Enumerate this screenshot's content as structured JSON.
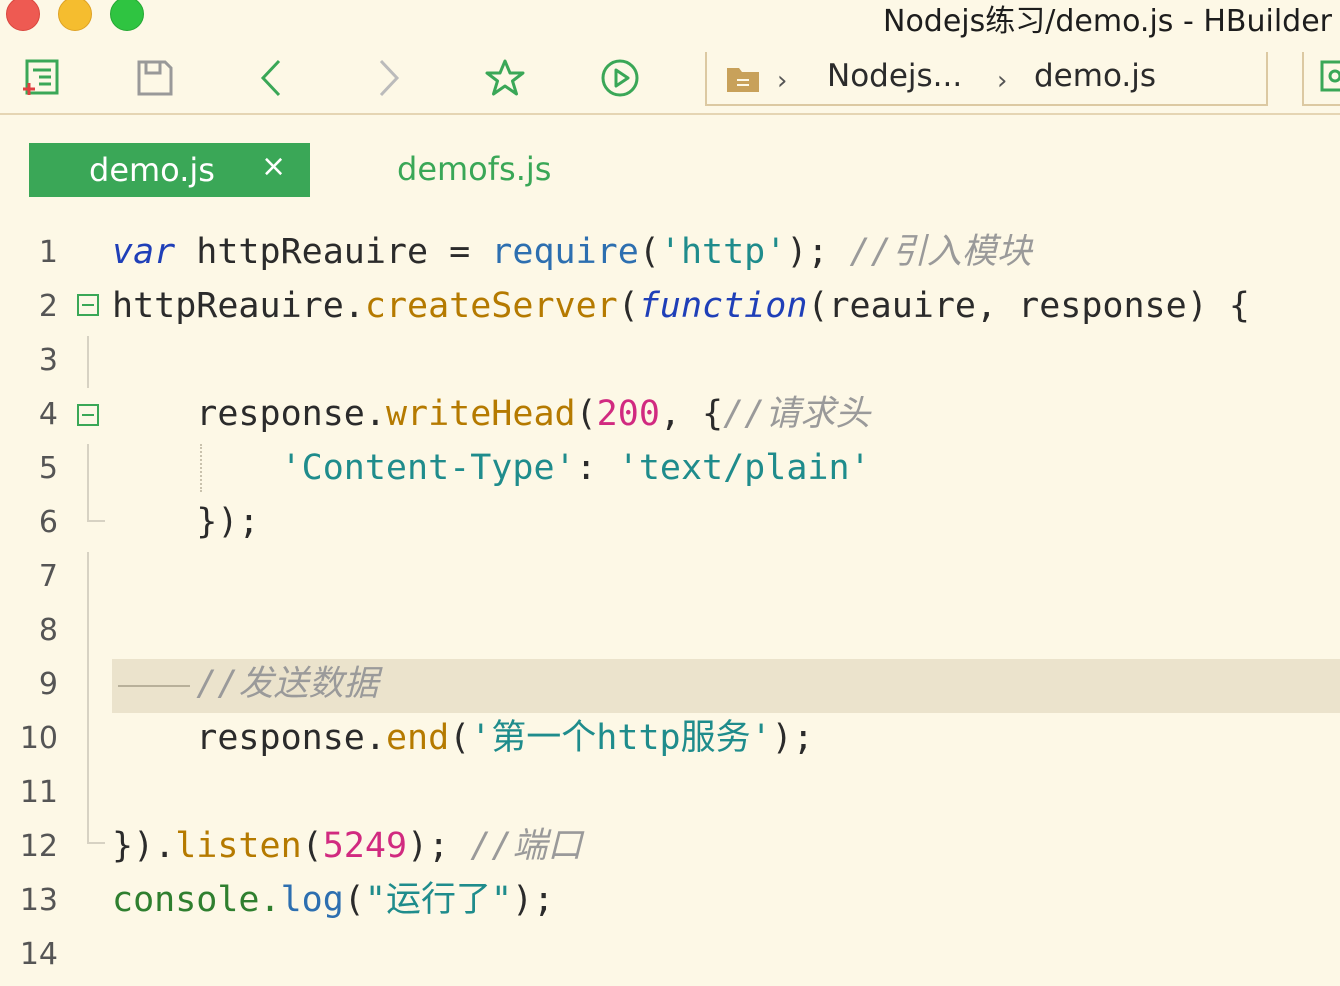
{
  "window": {
    "title": "Nodejs练习/demo.js - HBuilder"
  },
  "toolbar": {
    "buttons": [
      "new-file-icon",
      "save-icon",
      "back-icon",
      "forward-icon",
      "favorite-icon",
      "run-icon"
    ],
    "breadcrumb": {
      "project": "Nodejs...",
      "file": "demo.js"
    }
  },
  "tabs": [
    {
      "label": "demo.js",
      "active": true,
      "close": "×"
    },
    {
      "label": "demofs.js",
      "active": false
    }
  ],
  "editor": {
    "line_numbers": [
      "1",
      "2",
      "3",
      "4",
      "5",
      "6",
      "7",
      "8",
      "9",
      "10",
      "11",
      "12",
      "13",
      "14"
    ],
    "highlighted_line": "9",
    "lines": [
      [
        {
          "t": "var",
          "c": "kw"
        },
        {
          "t": " httpReauire = ",
          "c": "plain"
        },
        {
          "t": "require",
          "c": "req"
        },
        {
          "t": "(",
          "c": "plain"
        },
        {
          "t": "'http'",
          "c": "str"
        },
        {
          "t": "); ",
          "c": "plain"
        },
        {
          "t": "//引入模块",
          "c": "cm"
        }
      ],
      [
        {
          "t": "httpReauire.",
          "c": "plain"
        },
        {
          "t": "createServer",
          "c": "fn"
        },
        {
          "t": "(",
          "c": "plain"
        },
        {
          "t": "function",
          "c": "kw"
        },
        {
          "t": "(reauire, response) {",
          "c": "plain"
        }
      ],
      [],
      [
        {
          "t": "    response.",
          "c": "plain"
        },
        {
          "t": "writeHead",
          "c": "fn"
        },
        {
          "t": "(",
          "c": "plain"
        },
        {
          "t": "200",
          "c": "num"
        },
        {
          "t": ", {",
          "c": "plain"
        },
        {
          "t": "//请求头",
          "c": "cm"
        }
      ],
      [
        {
          "t": "        ",
          "c": "plain"
        },
        {
          "t": "'Content-Type'",
          "c": "str"
        },
        {
          "t": ": ",
          "c": "plain"
        },
        {
          "t": "'text/plain'",
          "c": "str"
        }
      ],
      [
        {
          "t": "    });",
          "c": "plain"
        }
      ],
      [],
      [],
      [
        {
          "t": "    ",
          "c": "plain"
        },
        {
          "t": "//发送数据",
          "c": "cm"
        }
      ],
      [
        {
          "t": "    response.",
          "c": "plain"
        },
        {
          "t": "end",
          "c": "fn"
        },
        {
          "t": "(",
          "c": "plain"
        },
        {
          "t": "'第一个http服务'",
          "c": "str"
        },
        {
          "t": ");",
          "c": "plain"
        }
      ],
      [],
      [
        {
          "t": "}).",
          "c": "plain"
        },
        {
          "t": "listen",
          "c": "fn"
        },
        {
          "t": "(",
          "c": "plain"
        },
        {
          "t": "5249",
          "c": "num"
        },
        {
          "t": "); ",
          "c": "plain"
        },
        {
          "t": "//端口",
          "c": "cm"
        }
      ],
      [
        {
          "t": "console.",
          "c": "con"
        },
        {
          "t": "log",
          "c": "req"
        },
        {
          "t": "(",
          "c": "plain"
        },
        {
          "t": "\"运行了\"",
          "c": "str"
        },
        {
          "t": ");",
          "c": "plain"
        }
      ],
      []
    ]
  },
  "colors": {
    "accent": "#3aa757",
    "background": "#fdf8e6",
    "highlight": "#ebe3cc"
  }
}
